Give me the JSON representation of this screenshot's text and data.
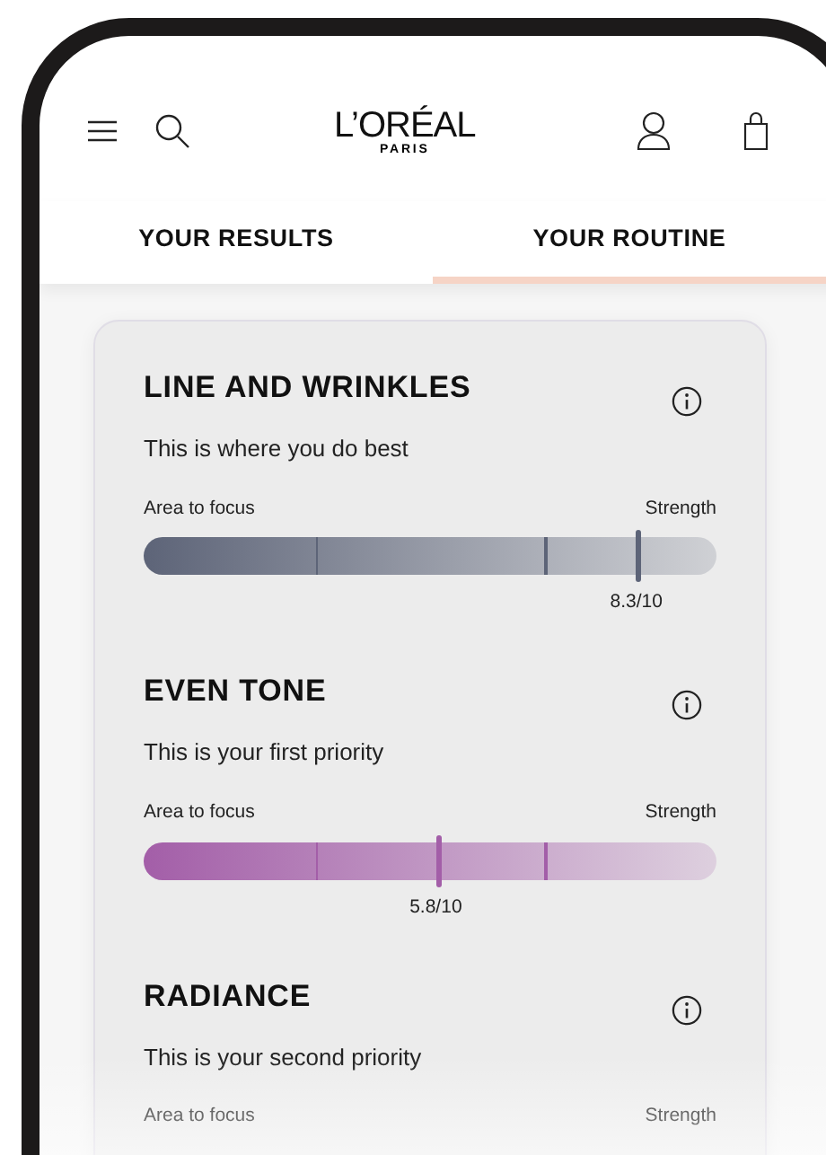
{
  "header": {
    "logo": "L’ORÉAL",
    "logo_sub": "PARIS"
  },
  "tabs": [
    {
      "label": "YOUR RESULTS",
      "selected": false
    },
    {
      "label": "YOUR ROUTINE",
      "selected": true
    }
  ],
  "sections": [
    {
      "title": "LINE AND WRINKLES",
      "subtitle": "This is where you do best",
      "left_label": "Area to focus",
      "right_label": "Strength",
      "color": "#5d6478",
      "level": 0.86,
      "reading": "8.3/10"
    },
    {
      "title": "EVEN TONE",
      "subtitle": "This is your first priority",
      "left_label": "Area to focus",
      "right_label": "Strength",
      "color": "#a35ea8",
      "level": 0.51,
      "reading": "5.8/10"
    },
    {
      "title": "RADIANCE",
      "subtitle": "This is your second priority",
      "left_label": "Area to focus",
      "right_label": "Strength"
    }
  ]
}
